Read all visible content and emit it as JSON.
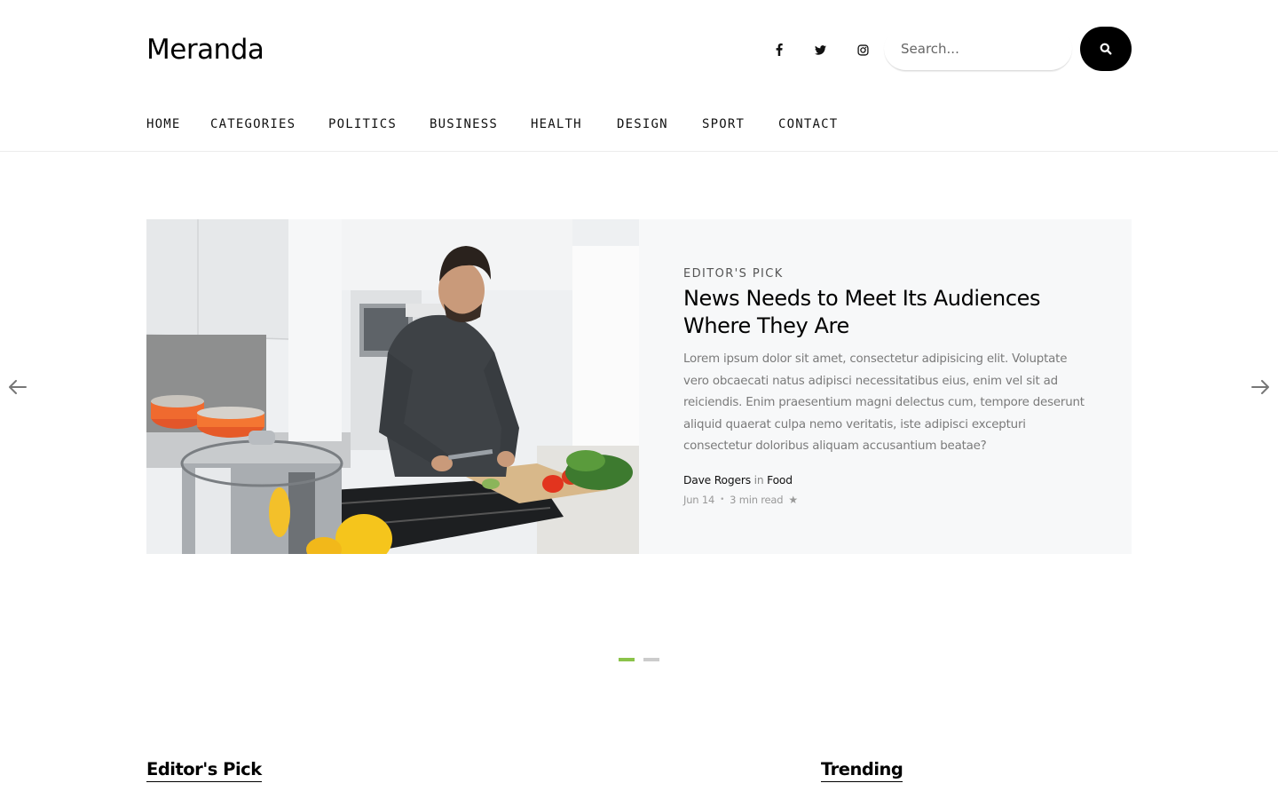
{
  "site": {
    "logo": "Meranda"
  },
  "social": [
    {
      "name": "facebook-icon"
    },
    {
      "name": "twitter-icon"
    },
    {
      "name": "instagram-icon"
    }
  ],
  "search": {
    "placeholder": "Search...",
    "value": ""
  },
  "nav": {
    "items": [
      {
        "label": "HOME"
      },
      {
        "label": "CATEGORIES"
      },
      {
        "label": "POLITICS"
      },
      {
        "label": "BUSINESS"
      },
      {
        "label": "HEALTH"
      },
      {
        "label": "DESIGN"
      },
      {
        "label": "SPORT"
      },
      {
        "label": "CONTACT"
      }
    ]
  },
  "hero": {
    "eyebrow": "EDITOR'S PICK",
    "title": "News Needs to Meet Its Audiences Where They Are",
    "excerpt": "Lorem ipsum dolor sit amet, consectetur adipisicing elit. Voluptate vero obcaecati natus adipisci necessitatibus eius, enim vel sit ad reiciendis. Enim praesentium magni delectus cum, tempore deserunt aliquid quaerat culpa nemo veritatis, iste adipisci excepturi consectetur doloribus aliquam accusantium beatae?",
    "author": "Dave Rogers",
    "in_word": "in",
    "category": "Food",
    "date": "Jun 14",
    "separator": "•",
    "read_time": "3 min read",
    "star": "★"
  },
  "slider": {
    "active_index": 0,
    "count": 2
  },
  "sections": {
    "left_heading": "Editor's Pick",
    "right_heading": "Trending"
  },
  "colors": {
    "accent": "#8bc34a",
    "inactive_dot": "#cccccc",
    "panel_bg": "#f7f8f9",
    "button_bg": "#000000"
  }
}
